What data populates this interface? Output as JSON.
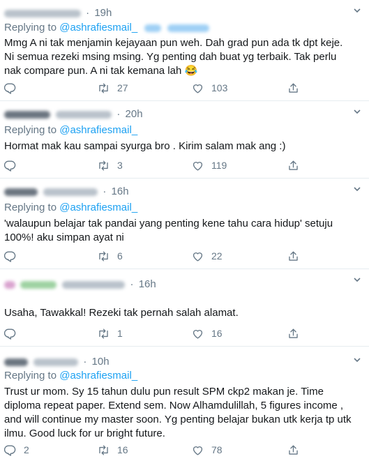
{
  "tweets": [
    {
      "time": "19h",
      "replying_prefix": "Replying to",
      "reply_handle": "@ashrafiesmail_",
      "text": "Mmg A ni tak menjamin kejayaan pun weh. Dah grad pun ada tk dpt keje. Ni semua rezeki msing msing. Yg penting dah buat yg terbaik. Tak perlu nak compare pun. A ni tak kemana lah 😂",
      "replies": "",
      "retweets": "27",
      "likes": "103"
    },
    {
      "time": "20h",
      "replying_prefix": "Replying to",
      "reply_handle": "@ashrafiesmail_",
      "text": "Hormat mak kau sampai syurga bro . Kirim salam mak ang :)",
      "replies": "",
      "retweets": "3",
      "likes": "119"
    },
    {
      "time": "16h",
      "replying_prefix": "Replying to",
      "reply_handle": "@ashrafiesmail_",
      "text": "'walaupun belajar tak pandai yang penting kene tahu cara hidup' setuju 100%! aku simpan ayat ni",
      "replies": "",
      "retweets": "6",
      "likes": "22"
    },
    {
      "time": "16h",
      "replying_prefix": "",
      "reply_handle": "",
      "text": "Usaha, Tawakkal! Rezeki tak pernah salah alamat.",
      "replies": "",
      "retweets": "1",
      "likes": "16"
    },
    {
      "time": "10h",
      "replying_prefix": "Replying to",
      "reply_handle": "@ashrafiesmail_",
      "text": "Trust ur mom. Sy 15 tahun dulu pun result SPM ckp2 makan je. Time diploma repeat paper. Extend sem. Now Alhamdulillah, 5 figures income , and will continue my master soon. Yg penting belajar bukan utk kerja tp utk ilmu. Good luck for ur bright future.",
      "replies": "2",
      "retweets": "16",
      "likes": "78"
    }
  ],
  "icons": {
    "reply": "reply-icon",
    "retweet": "retweet-icon",
    "like": "heart-icon",
    "share": "share-icon",
    "more": "chevron-down-icon"
  },
  "colors": {
    "handle": "#1da1f2",
    "secondary_text": "#657786",
    "divider": "#e6ecf0"
  }
}
